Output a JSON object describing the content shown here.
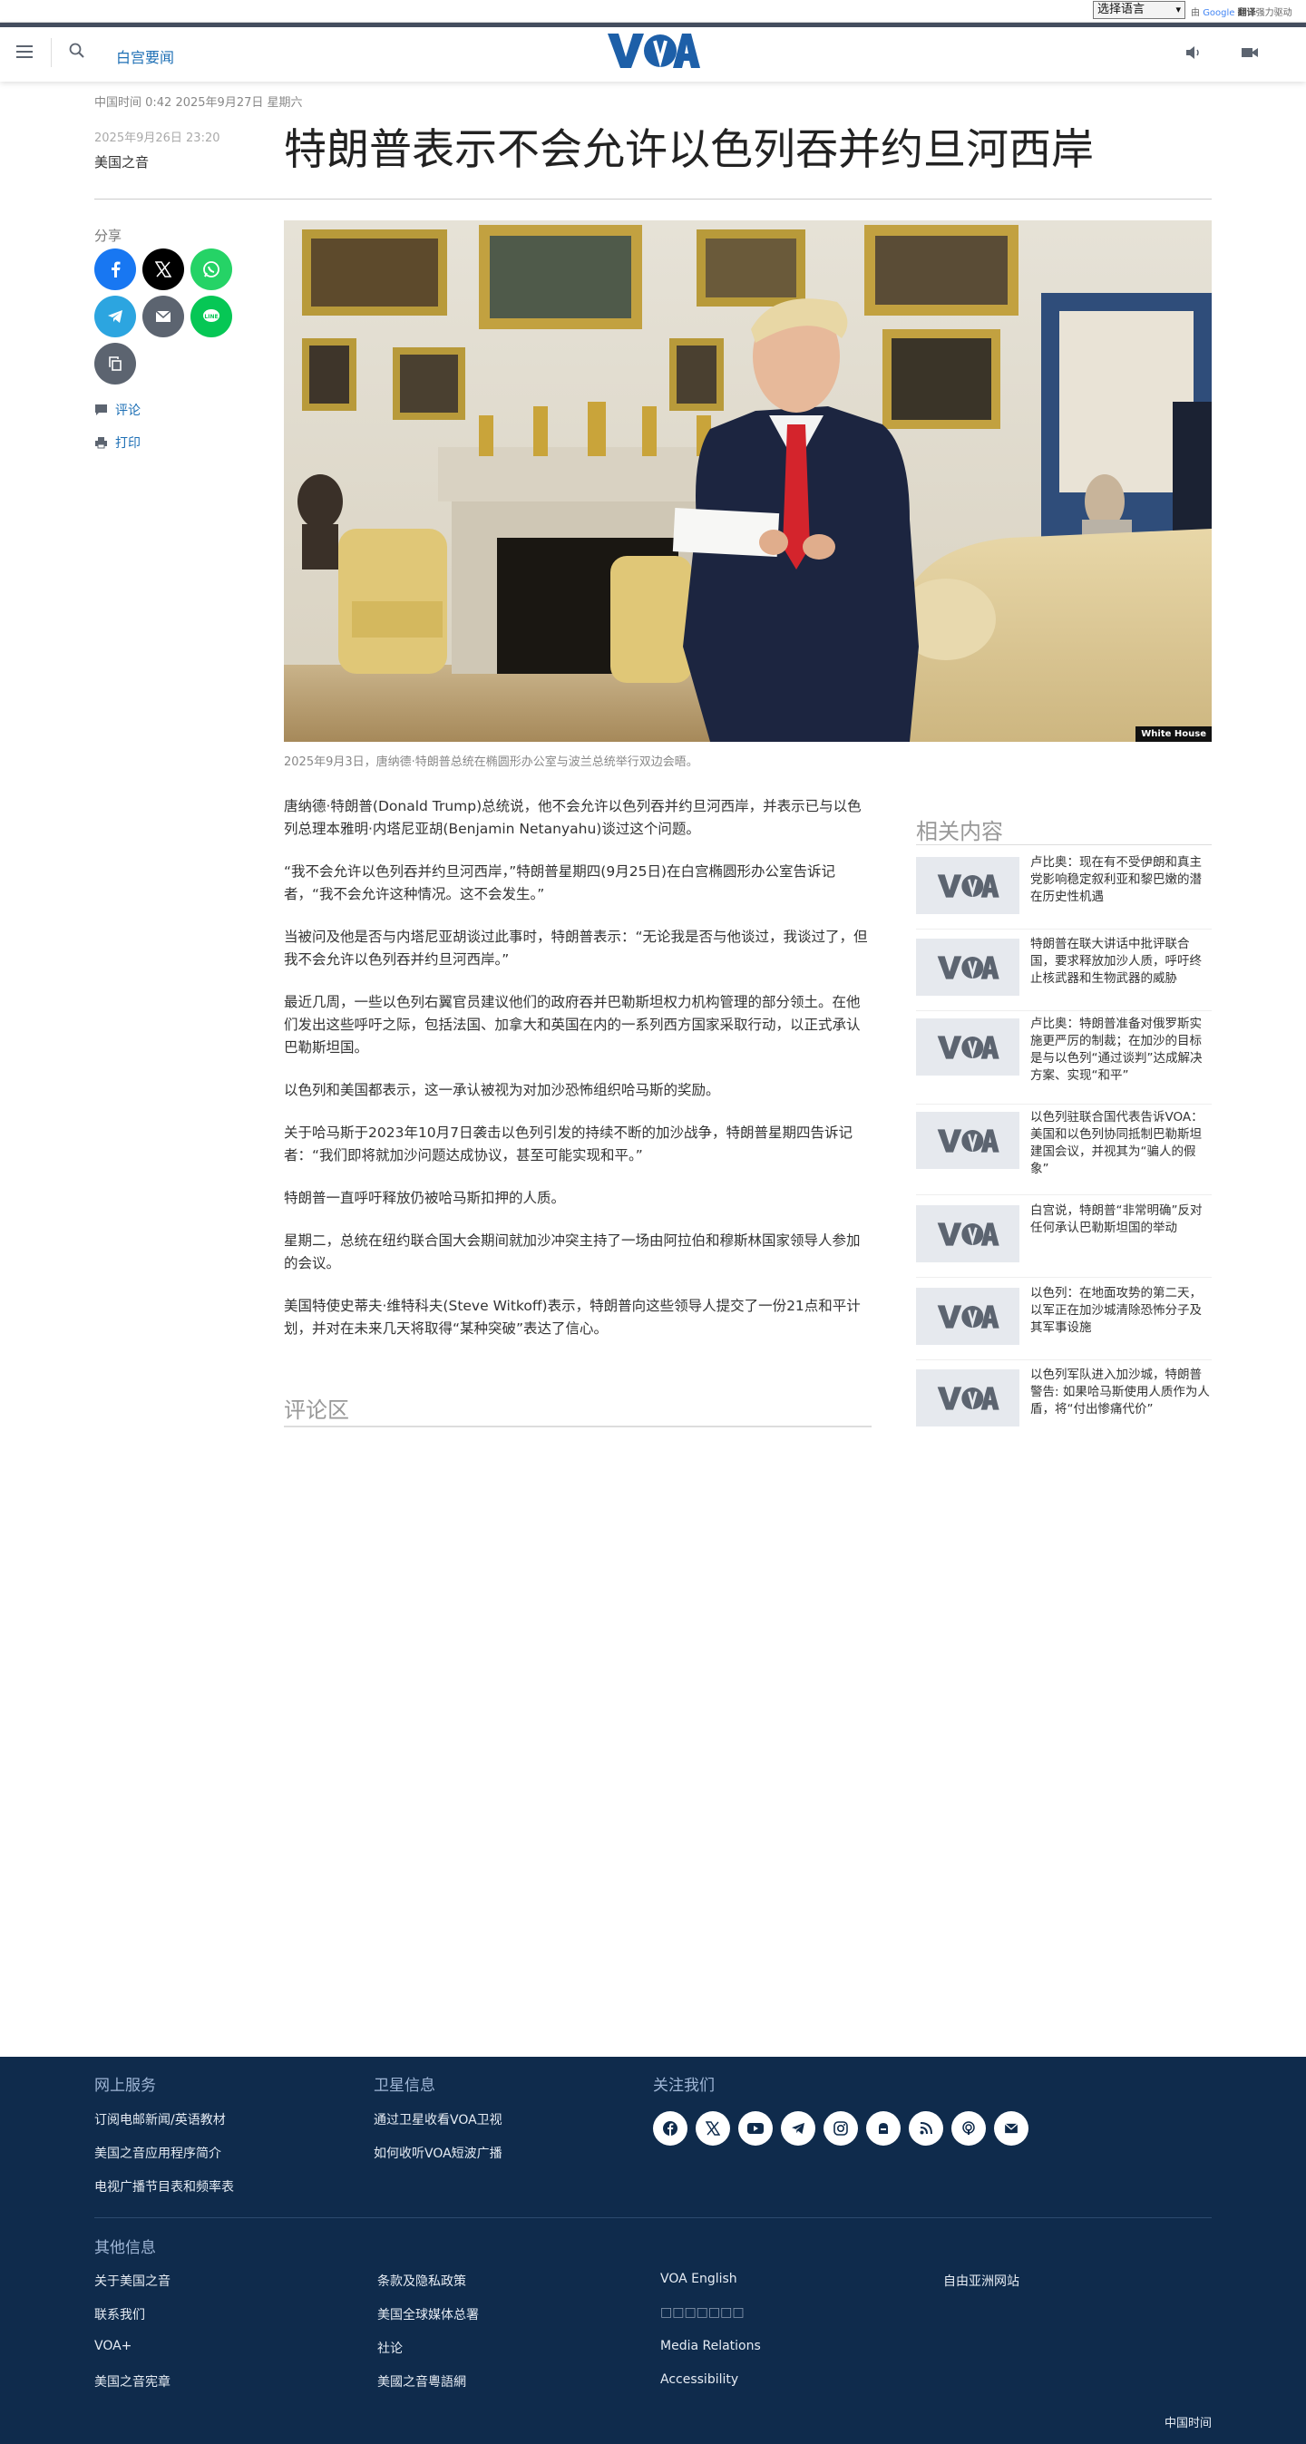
{
  "translate": {
    "select_label": "选择语言",
    "powered_by": "由",
    "google": "Google",
    "translate_text": "翻译",
    "powered_suffix": "强力驱动"
  },
  "header": {
    "section": "白宫要闻",
    "logo_text": "VOA"
  },
  "article": {
    "time_line": "中国时间 0:42 2025年9月27日 星期六",
    "pub_date": "2025年9月26日 23:20",
    "byline": "美国之音",
    "title": "特朗普表示不会允许以色列吞并约旦河西岸",
    "photo_credit": "White House",
    "caption": "2025年9月3日，唐纳德·特朗普总统在椭圆形办公室与波兰总统举行双边会晤。",
    "paragraphs": [
      "唐纳德·特朗普(Donald Trump)总统说，他不会允许以色列吞并约旦河西岸，并表示已与以色列总理本雅明·内塔尼亚胡(Benjamin Netanyahu)谈过这个问题。",
      "“我不会允许以色列吞并约旦河西岸，”特朗普星期四(9月25日)在白宫椭圆形办公室告诉记者，“我不会允许这种情况。这不会发生。”",
      "当被问及他是否与内塔尼亚胡谈过此事时，特朗普表示：“无论我是否与他谈过，我谈过了，但我不会允许以色列吞并约旦河西岸。”",
      "最近几周，一些以色列右翼官员建议他们的政府吞并巴勒斯坦权力机构管理的部分领土。在他们发出这些呼吁之际，包括法国、加拿大和英国在内的一系列西方国家采取行动，以正式承认巴勒斯坦国。",
      "以色列和美国都表示，这一承认被视为对加沙恐怖组织哈马斯的奖励。",
      "关于哈马斯于2023年10月7日袭击以色列引发的持续不断的加沙战争，特朗普星期四告诉记者：“我们即将就加沙问题达成协议，甚至可能实现和平。”",
      "特朗普一直呼吁释放仍被哈马斯扣押的人质。",
      "星期二，总统在纽约联合国大会期间就加沙冲突主持了一场由阿拉伯和穆斯林国家领导人参加的会议。",
      "美国特使史蒂夫·维特科夫(Steve Witkoff)表示，特朗普向这些领导人提交了一份21点和平计划，并对在未来几天将取得“某种突破”表达了信心。"
    ],
    "comments_heading": "评论区"
  },
  "share": {
    "label": "分享",
    "comment": "评论",
    "print": "打印"
  },
  "related": {
    "heading": "相关内容",
    "items": [
      "卢比奥：现在有不受伊朗和真主党影响稳定叙利亚和黎巴嫩的潜在历史性机遇",
      "特朗普在联大讲话中批评联合国，要求释放加沙人质，呼吁终止核武器和生物武器的威胁",
      "卢比奥：特朗普准备对俄罗斯实施更严厉的制裁；在加沙的目标是与以色列“通过谈判”达成解决方案、实现“和平”",
      "以色列驻联合国代表告诉VOA：美国和以色列协同抵制巴勒斯坦建国会议，并视其为“骗人的假象”",
      "白宫说，特朗普“非常明确”反对任何承认巴勒斯坦国的举动",
      "以色列：在地面攻势的第二天，以军正在加沙城清除恐怖分子及其军事设施",
      "以色列军队进入加沙城，特朗普警告: 如果哈马斯使用人质作为人盾，将“付出惨痛代价”"
    ]
  },
  "footer": {
    "online_heading": "网上服务",
    "online_links": [
      "订阅电邮新闻/英语教材",
      "美国之音应用程序简介",
      "电视广播节目表和频率表"
    ],
    "satellite_heading": "卫星信息",
    "satellite_links": [
      "通过卫星收看VOA卫视",
      "如何收听VOA短波广播"
    ],
    "follow_heading": "关注我们",
    "social_icons": [
      "facebook-icon",
      "x-icon",
      "youtube-icon",
      "telegram-icon",
      "instagram-icon",
      "podcast-icon",
      "rss-icon",
      "podcast-app-icon",
      "email-icon"
    ],
    "other_heading": "其他信息",
    "col1": [
      "关于美国之音",
      "联系我们",
      "VOA+",
      "美国之音宪章"
    ],
    "col2": [
      "条款及隐私政策",
      "美国全球媒体总署",
      "社论",
      "美國之音粵語網"
    ],
    "col3": [
      "VOA English",
      "□□□□□□□",
      "Media Relations",
      "Accessibility"
    ],
    "col4": [
      "自由亚洲网站"
    ],
    "timezone": "中国时间"
  }
}
